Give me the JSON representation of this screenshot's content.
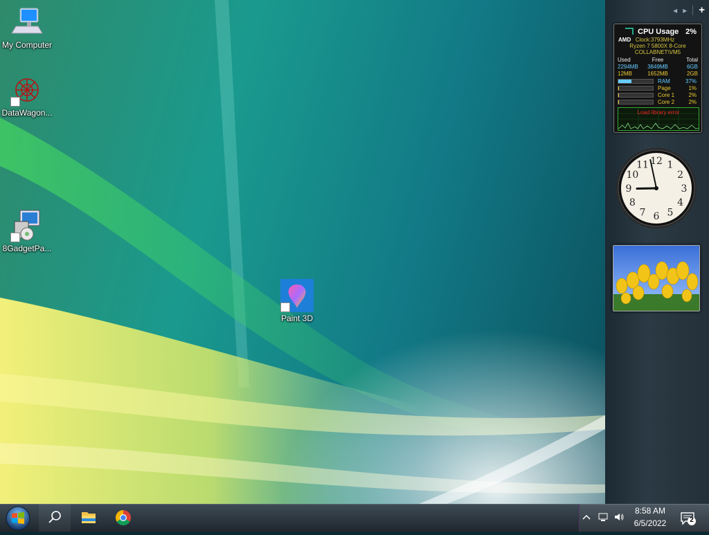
{
  "desktop": {
    "icons": [
      {
        "label": "My Computer",
        "icon": "computer-icon"
      },
      {
        "label": "DataWagon...",
        "icon": "datawagon-icon"
      },
      {
        "label": "8GadgetPa...",
        "icon": "installer-icon"
      },
      {
        "label": "Paint 3D",
        "icon": "paint3d-icon"
      }
    ]
  },
  "sidebar": {
    "controls": {
      "prev": "◂",
      "next": "▸",
      "add": "+"
    },
    "cpu_gadget": {
      "brand": "AMD",
      "title": "CPU Usage",
      "usage": "2%",
      "clock": "Clock:3793MHz",
      "model": "Ryzen 7 5800X 8-Core",
      "host": "COLLABNET\\VM5",
      "headers": [
        "Used",
        "Free",
        "Total"
      ],
      "ram_row": [
        "2294MB",
        "3849MB",
        "6GB"
      ],
      "page_row": [
        "12MB",
        "1652MB",
        "2GB"
      ],
      "meters": [
        {
          "name": "RAM",
          "value": "37%",
          "fraction": 0.37,
          "color": "#6cf"
        },
        {
          "name": "Page",
          "value": "1%",
          "fraction": 0.01,
          "color": "#ec3"
        },
        {
          "name": "Core 1",
          "value": "2%",
          "fraction": 0.02,
          "color": "#ec3"
        },
        {
          "name": "Core 2",
          "value": "2%",
          "fraction": 0.02,
          "color": "#ec3"
        }
      ],
      "graph_error": "Load library error"
    },
    "clock_gadget": {
      "numbers": [
        "12",
        "1",
        "2",
        "3",
        "4",
        "5",
        "6",
        "7",
        "8",
        "9",
        "10",
        "11"
      ],
      "hour": 8,
      "minute": 58
    },
    "slideshow": {
      "subject": "yellow tulips"
    }
  },
  "taskbar": {
    "start": "start-orb-icon",
    "search": "search-icon",
    "pinned": [
      "file-explorer-icon",
      "chrome-icon"
    ],
    "tray": {
      "time": "8:58 AM",
      "date": "6/5/2022",
      "notification_count": "2"
    }
  },
  "colors": {
    "accent": "#2a8",
    "cpu_yellow": "#d6c640",
    "taskbar": "#2a343c"
  }
}
